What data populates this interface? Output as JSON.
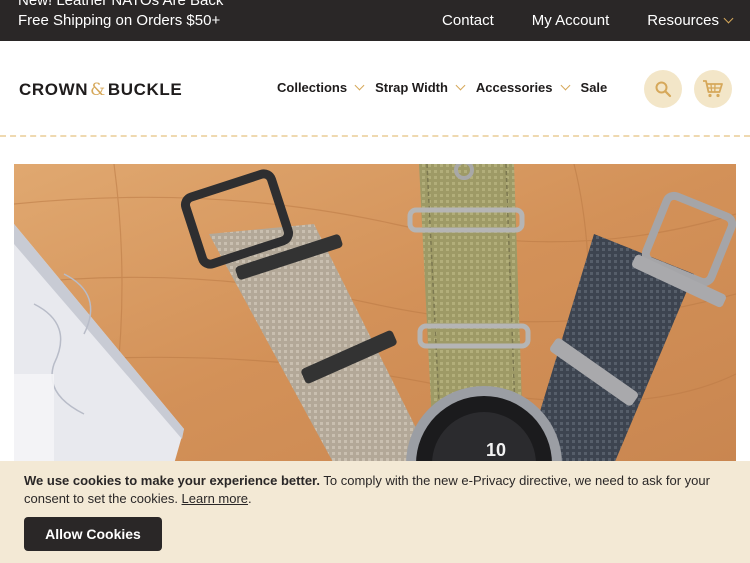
{
  "promo": {
    "line1": "New! Leather NATOs Are Back",
    "line2": "Free Shipping on Orders $50+"
  },
  "topnav": {
    "contact": "Contact",
    "account": "My Account",
    "resources": "Resources"
  },
  "brand": {
    "left": "CROWN",
    "amp": "&",
    "right": "BUCKLE"
  },
  "mainnav": {
    "items": [
      {
        "label": "Collections"
      },
      {
        "label": "Strap Width"
      },
      {
        "label": "Accessories"
      },
      {
        "label": "Sale"
      }
    ]
  },
  "icons": {
    "search": "search-icon",
    "cart": "cart-icon"
  },
  "hero": {
    "dial_number": "10"
  },
  "cookie": {
    "bold": "We use cookies to make your experience better.",
    "text": " To comply with the new e-Privacy directive, we need to ask for your consent to set the cookies. ",
    "link": "Learn more",
    "tail": ".",
    "button": "Allow Cookies"
  },
  "colors": {
    "topbar": "#2a2727",
    "accent": "#d6a85a",
    "icon_bg": "#f3e6c8",
    "cookie_bg": "#f3e9d5"
  }
}
